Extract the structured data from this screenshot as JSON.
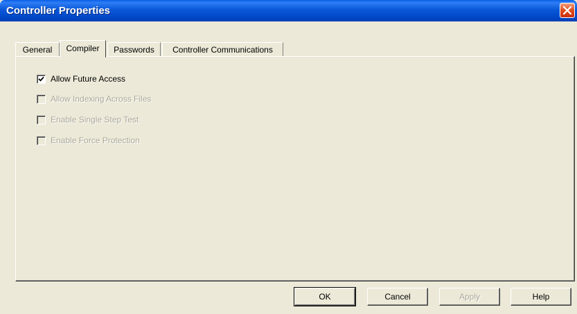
{
  "window": {
    "title": "Controller Properties"
  },
  "tabs": [
    {
      "label": "General",
      "active": false
    },
    {
      "label": "Compiler",
      "active": true
    },
    {
      "label": "Passwords",
      "active": false
    },
    {
      "label": "Controller Communications",
      "active": false
    }
  ],
  "compiler": {
    "options": [
      {
        "label": "Allow Future Access",
        "checked": true,
        "enabled": true
      },
      {
        "label": "Allow Indexing Across Files",
        "checked": false,
        "enabled": false
      },
      {
        "label": "Enable Single Step Test",
        "checked": false,
        "enabled": false
      },
      {
        "label": "Enable Force Protection",
        "checked": false,
        "enabled": false
      }
    ]
  },
  "buttons": {
    "ok": "OK",
    "cancel": "Cancel",
    "apply": "Apply",
    "help": "Help"
  },
  "colors": {
    "title_bar": "#0a58d8",
    "dialog_bg": "#ece9d8",
    "disabled_text": "#aca899",
    "close_button": "#e04c1c"
  }
}
